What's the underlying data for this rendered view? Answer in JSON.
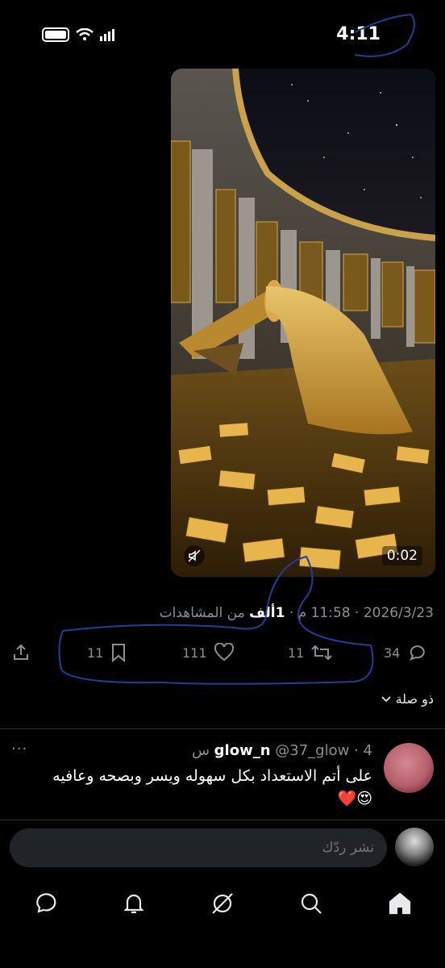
{
  "status_bar": {
    "time": "4:11"
  },
  "media": {
    "duration": "0:02"
  },
  "meta": {
    "date": "2026/3/23",
    "separator": "·",
    "time": "11:58 م",
    "views_count": "1ألف",
    "views_label": "من المشاهدات"
  },
  "actions": {
    "replies": "34",
    "reposts": "11",
    "likes": "111",
    "bookmarks": "11"
  },
  "related": {
    "label": "ذو صلة"
  },
  "reply": {
    "display_name": "glow_n",
    "handle": "@37_glow",
    "time": "4 س",
    "separator": "·",
    "text": "على أتم الاستعداد بكل سهوله ويسر وبصحه وعافيه",
    "emojis": "😍❤️",
    "more": "···"
  },
  "composer": {
    "placeholder": "نشر ردّك"
  },
  "colors": {
    "background": "#000000",
    "muted": "#8b8f94",
    "pen": "#1f3f9a"
  }
}
